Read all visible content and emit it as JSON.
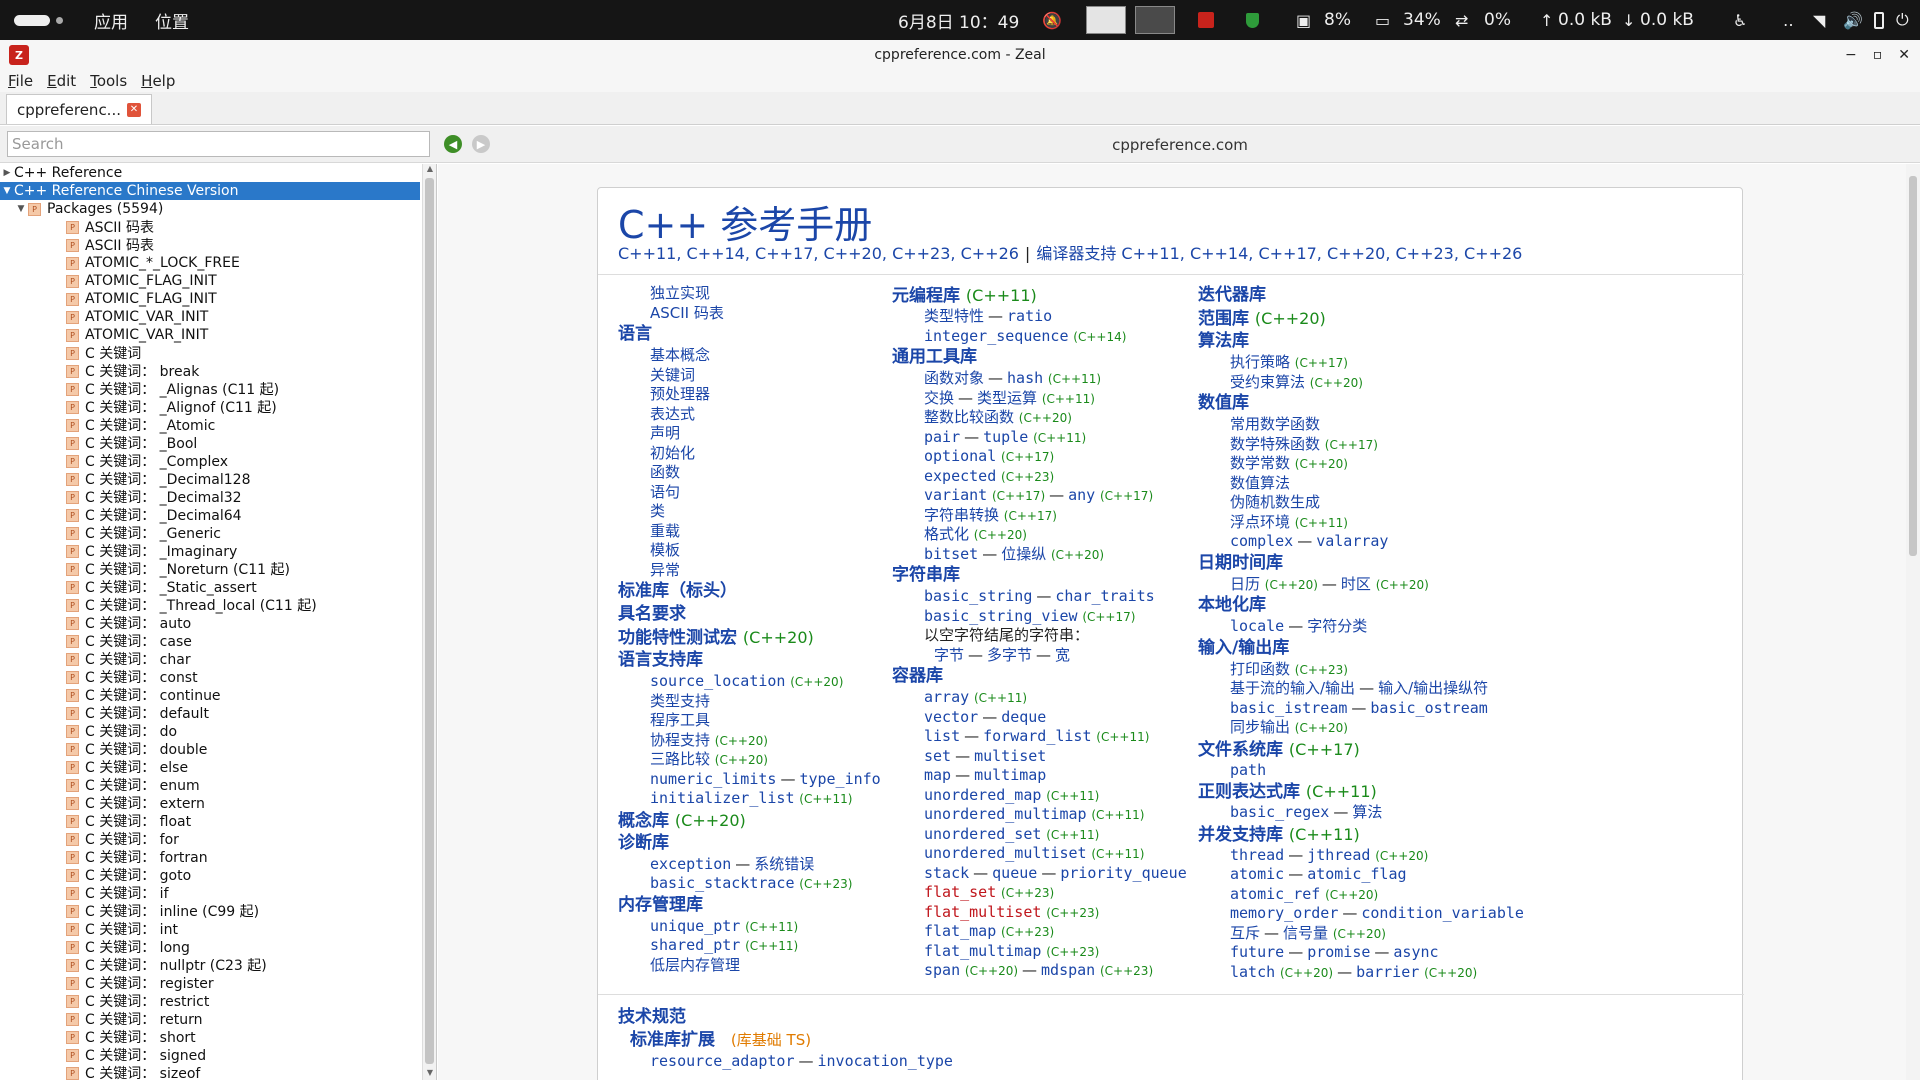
{
  "topbar": {
    "apps": "应用",
    "places": "位置",
    "datetime": "6月8日 10：49",
    "cpu": "8%",
    "mem": "34%",
    "swap": "0%",
    "net_up": "0.0 kB",
    "net_down": "0.0 kB"
  },
  "window": {
    "title": "cppreference.com - Zeal",
    "controls": [
      "−",
      "▫",
      "✕"
    ]
  },
  "menu": [
    "File",
    "Edit",
    "Tools",
    "Help"
  ],
  "tab": {
    "label": "cppreferenc..."
  },
  "search": {
    "placeholder": "Search",
    "page_url": "cppreference.com"
  },
  "tree": {
    "root1": "C++ Reference",
    "root2": "C++ Reference Chinese Version",
    "packages": "Packages (5594)",
    "items": [
      "ASCII 码表",
      "ASCII 码表",
      "ATOMIC_*_LOCK_FREE",
      "ATOMIC_FLAG_INIT",
      "ATOMIC_FLAG_INIT",
      "ATOMIC_VAR_INIT",
      "ATOMIC_VAR_INIT",
      "C 关键词",
      "C 关键词： break",
      "C 关键词： _Alignas (C11 起)",
      "C 关键词： _Alignof (C11 起)",
      "C 关键词： _Atomic",
      "C 关键词： _Bool",
      "C 关键词： _Complex",
      "C 关键词： _Decimal128",
      "C 关键词： _Decimal32",
      "C 关键词： _Decimal64",
      "C 关键词： _Generic",
      "C 关键词： _Imaginary",
      "C 关键词： _Noreturn (C11 起)",
      "C 关键词： _Static_assert",
      "C 关键词： _Thread_local (C11 起)",
      "C 关键词： auto",
      "C 关键词： case",
      "C 关键词： char",
      "C 关键词： const",
      "C 关键词： continue",
      "C 关键词： default",
      "C 关键词： do",
      "C 关键词： double",
      "C 关键词： else",
      "C 关键词： enum",
      "C 关键词： extern",
      "C 关键词： float",
      "C 关键词： for",
      "C 关键词： fortran",
      "C 关键词： goto",
      "C 关键词： if",
      "C 关键词： inline (C99 起)",
      "C 关键词： int",
      "C 关键词： long",
      "C 关键词： nullptr (C23 起)",
      "C 关键词： register",
      "C 关键词： restrict",
      "C 关键词： return",
      "C 关键词： short",
      "C 关键词： signed",
      "C 关键词： sizeof"
    ]
  },
  "page": {
    "title": "C++ 参考手册",
    "std_versions": [
      "C++11",
      "C++14",
      "C++17",
      "C++20",
      "C++23",
      "C++26"
    ],
    "compiler_support": "编译器支持",
    "separator": "|",
    "col1": [
      {
        "k": "s",
        "t": "独立实现"
      },
      {
        "k": "s",
        "t": "ASCII 码表"
      },
      {
        "k": "h",
        "t": "语言"
      },
      {
        "k": "s",
        "t": "基本概念"
      },
      {
        "k": "s",
        "t": "关键词"
      },
      {
        "k": "s",
        "t": "预处理器"
      },
      {
        "k": "s",
        "t": "表达式"
      },
      {
        "k": "s",
        "t": "声明"
      },
      {
        "k": "s",
        "t": "初始化"
      },
      {
        "k": "s",
        "t": "函数"
      },
      {
        "k": "s",
        "t": "语句"
      },
      {
        "k": "s",
        "t": "类"
      },
      {
        "k": "s",
        "t": "重载"
      },
      {
        "k": "s",
        "t": "模板"
      },
      {
        "k": "s",
        "t": "异常"
      },
      {
        "k": "h",
        "t": "标准库（标头）"
      },
      {
        "k": "h",
        "t": "具名要求"
      },
      {
        "k": "h",
        "t": "功能特性测试宏",
        "v": "(C++20)"
      },
      {
        "k": "h",
        "t": "语言支持库"
      },
      {
        "k": "s",
        "m": "source_location",
        "v": "(C++20)"
      },
      {
        "k": "s",
        "t": "类型支持"
      },
      {
        "k": "s",
        "t": "程序工具"
      },
      {
        "k": "s",
        "t": "协程支持",
        "v": "(C++20)"
      },
      {
        "k": "s",
        "t": "三路比较",
        "v": "(C++20)"
      },
      {
        "k": "s",
        "m": "numeric_limits",
        "m2": "type_info"
      },
      {
        "k": "s",
        "m": "initializer_list",
        "v": "(C++11)"
      },
      {
        "k": "h",
        "t": "概念库",
        "v": "(C++20)"
      },
      {
        "k": "h",
        "t": "诊断库"
      },
      {
        "k": "s",
        "m": "exception",
        "t2": "系统错误"
      },
      {
        "k": "s",
        "m": "basic_stacktrace",
        "v": "(C++23)"
      },
      {
        "k": "h",
        "t": "内存管理库"
      },
      {
        "k": "s",
        "m": "unique_ptr",
        "v": "(C++11)"
      },
      {
        "k": "s",
        "m": "shared_ptr",
        "v": "(C++11)"
      },
      {
        "k": "s",
        "t": "低层内存管理"
      }
    ],
    "col2": [
      {
        "k": "h",
        "t": "元编程库",
        "v": "(C++11)"
      },
      {
        "k": "s",
        "t": "类型特性",
        "m2": "ratio"
      },
      {
        "k": "s",
        "m": "integer_sequence",
        "v": "(C++14)"
      },
      {
        "k": "h",
        "t": "通用工具库"
      },
      {
        "k": "s",
        "t": "函数对象",
        "m2": "hash",
        "v": "(C++11)"
      },
      {
        "k": "s",
        "t": "交换",
        "t2": "类型运算",
        "v": "(C++11)"
      },
      {
        "k": "s",
        "t": "整数比较函数",
        "v": "(C++20)"
      },
      {
        "k": "s",
        "m": "pair",
        "m2": "tuple",
        "v": "(C++11)"
      },
      {
        "k": "s",
        "m": "optional",
        "v": "(C++17)"
      },
      {
        "k": "s",
        "m": "expected",
        "v": "(C++23)"
      },
      {
        "k": "s",
        "m": "variant",
        "v": "(C++17)",
        "m2": "any",
        "v2": "(C++17)"
      },
      {
        "k": "s",
        "t": "字符串转换",
        "v": "(C++17)"
      },
      {
        "k": "s",
        "t": "格式化",
        "v": "(C++20)"
      },
      {
        "k": "s",
        "m": "bitset",
        "t2": "位操纵",
        "v": "(C++20)"
      },
      {
        "k": "h",
        "t": "字符串库"
      },
      {
        "k": "s",
        "m": "basic_string",
        "m2": "char_traits"
      },
      {
        "k": "s",
        "m": "basic_string_view",
        "v": "(C++17)"
      },
      {
        "k": "plain",
        "t": "以空字符结尾的字符串："
      },
      {
        "k": "s2",
        "t": "字节",
        "t2": "多字节",
        "t3": "宽"
      },
      {
        "k": "h",
        "t": "容器库"
      },
      {
        "k": "s",
        "m": "array",
        "v": "(C++11)"
      },
      {
        "k": "s",
        "m": "vector",
        "m2": "deque"
      },
      {
        "k": "s",
        "m": "list",
        "m2": "forward_list",
        "v": "(C++11)"
      },
      {
        "k": "s",
        "m": "set",
        "m2": "multiset"
      },
      {
        "k": "s",
        "m": "map",
        "m2": "multimap"
      },
      {
        "k": "s",
        "m": "unordered_map",
        "v": "(C++11)"
      },
      {
        "k": "s",
        "m": "unordered_multimap",
        "v": "(C++11)"
      },
      {
        "k": "s",
        "m": "unordered_set",
        "v": "(C++11)"
      },
      {
        "k": "s",
        "m": "unordered_multiset",
        "v": "(C++11)"
      },
      {
        "k": "s",
        "m": "stack",
        "m2": "queue",
        "m3": "priority_queue"
      },
      {
        "k": "s",
        "m": "flat_set",
        "v": "(C++23)",
        "red": true
      },
      {
        "k": "s",
        "m": "flat_multiset",
        "v": "(C++23)",
        "red": true
      },
      {
        "k": "s",
        "m": "flat_map",
        "v": "(C++23)"
      },
      {
        "k": "s",
        "m": "flat_multimap",
        "v": "(C++23)"
      },
      {
        "k": "s",
        "m": "span",
        "v": "(C++20)",
        "m2": "mdspan",
        "v2": "(C++23)"
      }
    ],
    "col3": [
      {
        "k": "h",
        "t": "迭代器库"
      },
      {
        "k": "h",
        "t": "范围库",
        "v": "(C++20)"
      },
      {
        "k": "h",
        "t": "算法库"
      },
      {
        "k": "s",
        "t": "执行策略",
        "v": "(C++17)"
      },
      {
        "k": "s",
        "t": "受约束算法",
        "v": "(C++20)"
      },
      {
        "k": "h",
        "t": "数值库"
      },
      {
        "k": "s",
        "t": "常用数学函数"
      },
      {
        "k": "s",
        "t": "数学特殊函数",
        "v": "(C++17)"
      },
      {
        "k": "s",
        "t": "数学常数",
        "v": "(C++20)"
      },
      {
        "k": "s",
        "t": "数值算法"
      },
      {
        "k": "s",
        "t": "伪随机数生成"
      },
      {
        "k": "s",
        "t": "浮点环境",
        "v": "(C++11)"
      },
      {
        "k": "s",
        "m": "complex",
        "m2": "valarray"
      },
      {
        "k": "h",
        "t": "日期时间库"
      },
      {
        "k": "s",
        "t": "日历",
        "v": "(C++20)",
        "t2": "时区",
        "v2": "(C++20)"
      },
      {
        "k": "h",
        "t": "本地化库"
      },
      {
        "k": "s",
        "m": "locale",
        "t2": "字符分类"
      },
      {
        "k": "h",
        "t": "输入/输出库"
      },
      {
        "k": "s",
        "t": "打印函数",
        "v": "(C++23)"
      },
      {
        "k": "s",
        "t": "基于流的输入/输出",
        "t2": "输入/输出操纵符"
      },
      {
        "k": "s",
        "m": "basic_istream",
        "m2": "basic_ostream"
      },
      {
        "k": "s",
        "t": "同步输出",
        "v": "(C++20)"
      },
      {
        "k": "h",
        "t": "文件系统库",
        "v": "(C++17)"
      },
      {
        "k": "s",
        "m": "path"
      },
      {
        "k": "h",
        "t": "正则表达式库",
        "v": "(C++11)"
      },
      {
        "k": "s",
        "m": "basic_regex",
        "t2": "算法"
      },
      {
        "k": "h",
        "t": "并发支持库",
        "v": "(C++11)"
      },
      {
        "k": "s",
        "m": "thread",
        "m2": "jthread",
        "v": "(C++20)"
      },
      {
        "k": "s",
        "m": "atomic",
        "m2": "atomic_flag"
      },
      {
        "k": "s",
        "m": "atomic_ref",
        "v": "(C++20)"
      },
      {
        "k": "s",
        "m": "memory_order",
        "m2": "condition_variable"
      },
      {
        "k": "s",
        "t": "互斥",
        "t2": "信号量",
        "v": "(C++20)"
      },
      {
        "k": "s",
        "m": "future",
        "m2": "promise",
        "m3": "async"
      },
      {
        "k": "s",
        "m": "latch",
        "v": "(C++20)",
        "m2": "barrier",
        "v2": "(C++20)"
      }
    ],
    "ts": {
      "heading": "技术规范",
      "sub": "标准库扩展",
      "sub_note": "(库基础 TS)",
      "item1": "resource_adaptor",
      "item2": "invocation_type"
    }
  }
}
